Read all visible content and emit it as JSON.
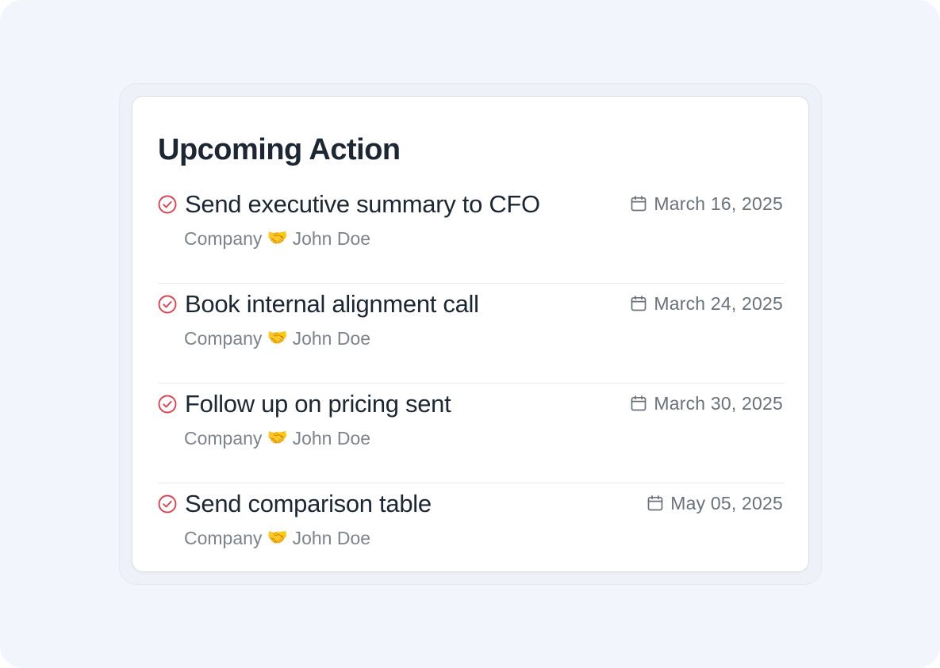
{
  "card": {
    "title": "Upcoming Action"
  },
  "actions": [
    {
      "title": "Send executive summary to CFO",
      "company": "Company",
      "contact": "John Doe",
      "date": "March 16, 2025"
    },
    {
      "title": "Book internal alignment call",
      "company": "Company",
      "contact": "John Doe",
      "date": "March 24, 2025"
    },
    {
      "title": "Follow up on pricing sent",
      "company": "Company",
      "contact": "John Doe",
      "date": "March 30, 2025"
    },
    {
      "title": "Send comparison table",
      "company": "Company",
      "contact": "John Doe",
      "date": "May 05, 2025"
    }
  ],
  "icons": {
    "check": "check-circle-icon",
    "calendar": "calendar-icon",
    "handshake": "handshake-icon"
  },
  "colors": {
    "check": "#e0414f",
    "title": "#1c2733",
    "meta": "#7d838c",
    "date": "#6a717b",
    "background": "#f2f5fc"
  }
}
